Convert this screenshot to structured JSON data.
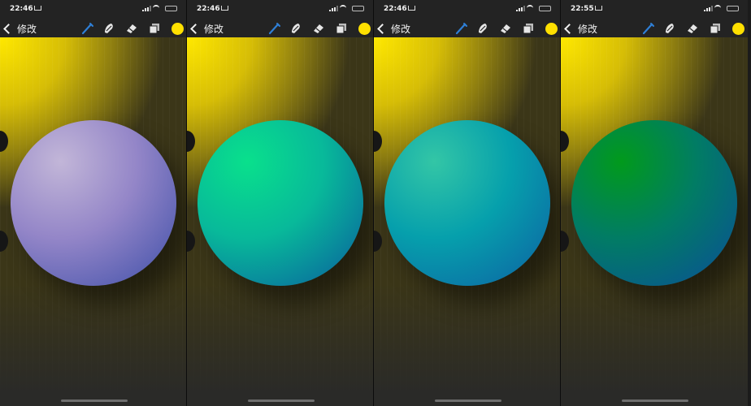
{
  "toolbar": {
    "back_label": "修改",
    "icons": [
      "brush-icon",
      "smudge-icon",
      "eraser-icon",
      "layers-icon"
    ],
    "accent_color": "#2f7fd6",
    "swatch_color": "#ffe000"
  },
  "screens": [
    {
      "time": "22:46",
      "orb": {
        "light": "#c2b6d8",
        "mid": "#9486c8",
        "dark": "#3d4ea8"
      }
    },
    {
      "time": "22:46",
      "orb": {
        "light": "#09e08c",
        "mid": "#08b99a",
        "dark": "#0a5a9e"
      }
    },
    {
      "time": "22:46",
      "orb": {
        "light": "#33c6a6",
        "mid": "#06a0ac",
        "dark": "#0d5fa3"
      }
    },
    {
      "time": "22:55",
      "orb": {
        "light": "#019a1c",
        "mid": "#017c64",
        "dark": "#0b4d9a"
      }
    }
  ]
}
